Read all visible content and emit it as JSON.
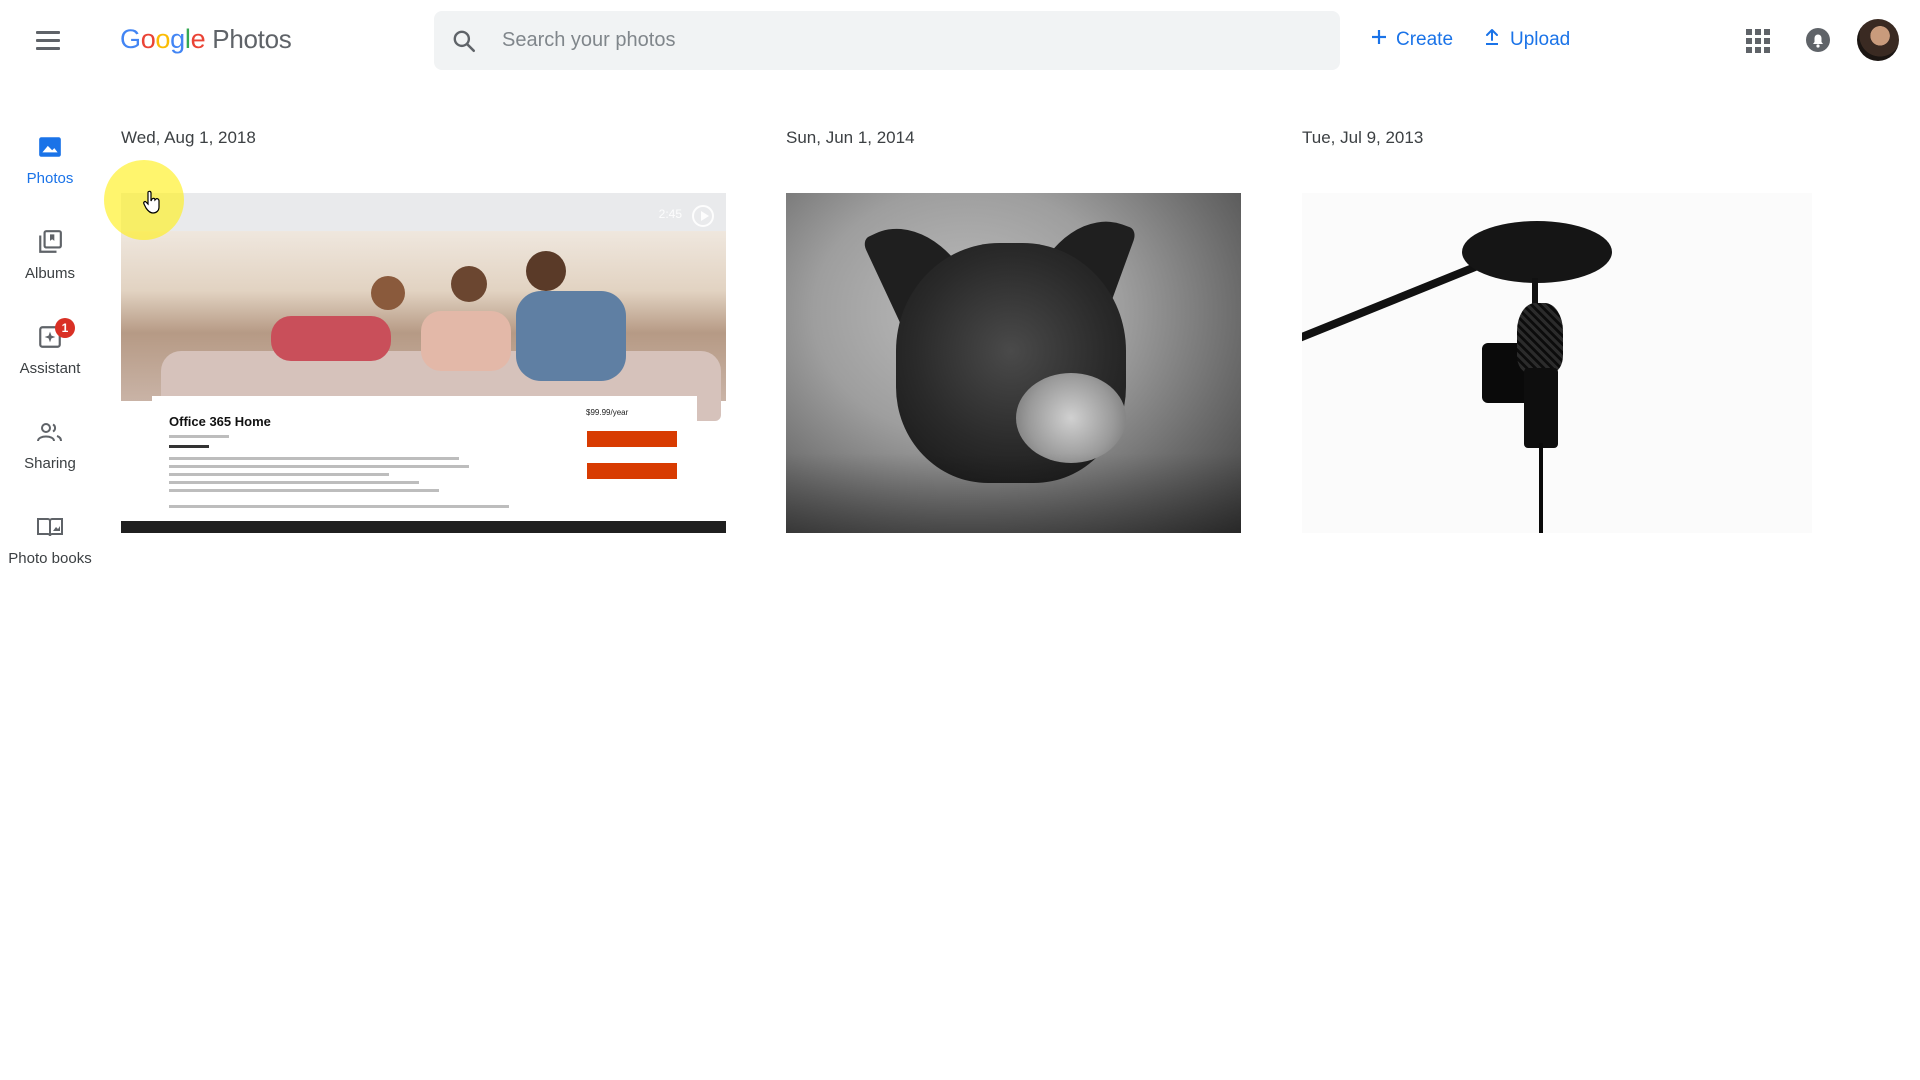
{
  "header": {
    "logo": {
      "brand_letters": [
        "G",
        "o",
        "o",
        "g",
        "l",
        "e"
      ],
      "product": "Photos"
    },
    "search": {
      "placeholder": "Search your photos",
      "value": ""
    },
    "actions": {
      "create_label": "Create",
      "upload_label": "Upload"
    },
    "icons": {
      "menu": "menu-icon",
      "search": "search-icon",
      "create": "plus-icon",
      "upload": "upload-icon",
      "apps": "apps-grid-icon",
      "notifications": "bell-icon",
      "avatar": "account-avatar"
    },
    "colors": {
      "accent": "#1a73e8",
      "google_blue": "#4285f4",
      "google_red": "#ea4335",
      "google_yellow": "#fbbc05",
      "google_green": "#34a853"
    }
  },
  "sidebar": {
    "items": [
      {
        "label": "Photos",
        "icon": "photo-icon",
        "active": true
      },
      {
        "label": "Albums",
        "icon": "albums-icon",
        "active": false
      },
      {
        "label": "Assistant",
        "icon": "assistant-icon",
        "active": false,
        "badge": "1"
      },
      {
        "label": "Sharing",
        "icon": "people-icon",
        "active": false
      },
      {
        "label": "Photo books",
        "icon": "book-icon",
        "active": false
      }
    ]
  },
  "groups": [
    {
      "date": "Wed, Aug 1, 2018",
      "item": {
        "type": "video",
        "duration": "2:45",
        "card_title": "Office 365 Home",
        "card_price": "$99.99/year"
      }
    },
    {
      "date": "Sun, Jun 1, 2014",
      "item": {
        "type": "photo"
      }
    },
    {
      "date": "Tue, Jul 9, 2013",
      "item": {
        "type": "photo"
      }
    }
  ]
}
